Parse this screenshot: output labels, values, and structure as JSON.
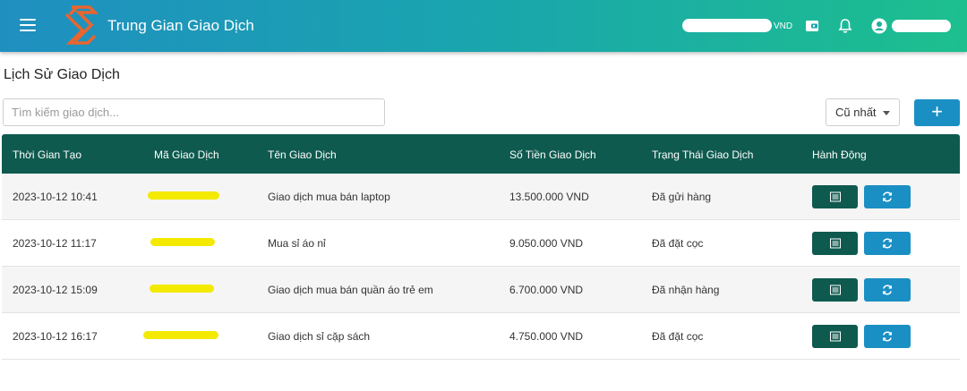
{
  "header": {
    "brand": "Trung Gian Giao Dịch",
    "currency_suffix": "VND",
    "icons": [
      "menu-icon",
      "logo-icon",
      "wallet-icon",
      "bell-icon",
      "account-icon"
    ],
    "colors": {
      "gradient_start": "#1f8fc0",
      "gradient_end": "#1dbf8e"
    }
  },
  "page": {
    "title": "Lịch Sử Giao Dịch",
    "search_placeholder": "Tìm kiếm giao dịch...",
    "sort_selected": "Cũ nhất",
    "add_label": "+"
  },
  "table": {
    "columns": [
      "Thời Gian Tạo",
      "Mã Giao Dịch",
      "Tên Giao Dịch",
      "Số Tiền Giao Dịch",
      "Trạng Thái Giao Dịch",
      "Hành Động"
    ],
    "rows": [
      {
        "time": "2023-10-12 10:41",
        "name": "Giao dịch mua bán laptop",
        "amount": "13.500.000 VND",
        "status": "Đã gửi hàng"
      },
      {
        "time": "2023-10-12 11:17",
        "name": "Mua sỉ áo nỉ",
        "amount": "9.050.000 VND",
        "status": "Đã đặt cọc"
      },
      {
        "time": "2023-10-12 15:09",
        "name": "Giao dịch mua bán quần áo trẻ em",
        "amount": "6.700.000 VND",
        "status": "Đã nhận hàng"
      },
      {
        "time": "2023-10-12 16:17",
        "name": "Giao dịch sỉ cặp sách",
        "amount": "4.750.000 VND",
        "status": "Đã đặt cọc"
      }
    ],
    "colors": {
      "header_bg": "#0f5a4f",
      "detail_button": "#0f5a4f",
      "refresh_button": "#1a8fc4"
    }
  }
}
